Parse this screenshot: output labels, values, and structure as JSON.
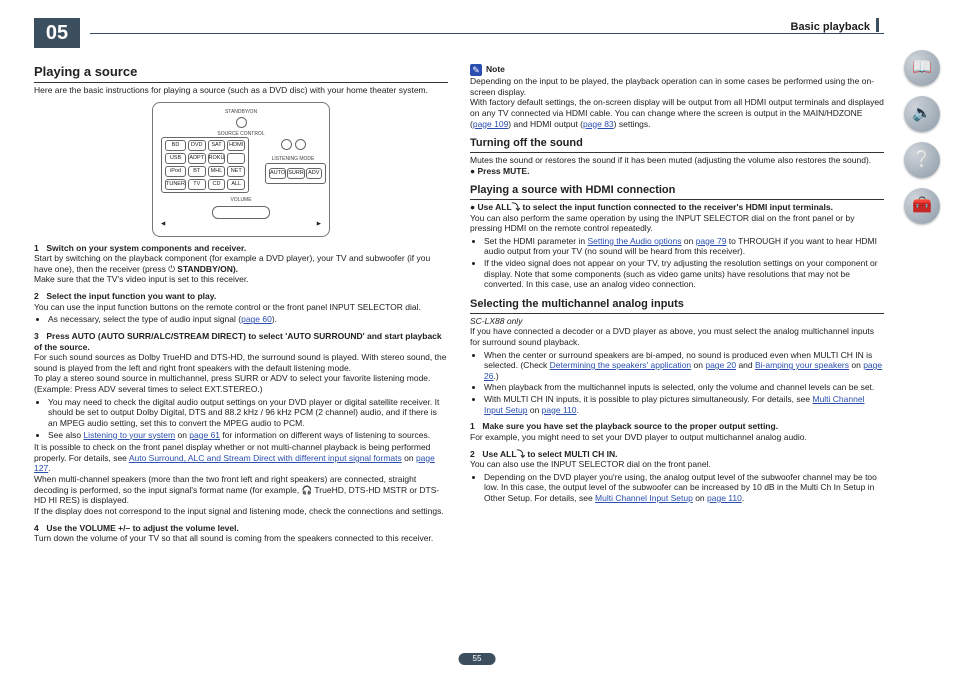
{
  "chapter": "05",
  "header": "Basic playback",
  "pagenum": "55",
  "left": {
    "title": "Playing a source",
    "intro": "Here are the basic instructions for playing a source (such as a DVD disc) with your home theater system.",
    "remote": {
      "standby": "STANDBY/ON",
      "src_lbl": "SOURCE CONTROL",
      "row1": [
        "BD",
        "DVD",
        "SAT",
        "HDMI"
      ],
      "row2": [
        "USB",
        "ADPT",
        "ROKU",
        ""
      ],
      "row3": [
        "iPod",
        "BT",
        "MHL",
        "NET"
      ],
      "row4": [
        "TUNER",
        "TV",
        "CD",
        "ALL"
      ],
      "listen_lbl": "LISTENING MODE",
      "listen": [
        "AUTO",
        "SURR",
        "ADV"
      ],
      "vol_lbl": "VOLUME"
    },
    "s1": "Switch on your system components and receiver.",
    "s1b": "Start by switching on the playback component (for example a DVD player), your TV and subwoofer (if you have one), then the receiver (press ",
    "s1c": " STANDBY/ON).",
    "s1d": "Make sure that the TV's video input is set to this receiver.",
    "s2": "Select the input function you want to play.",
    "s2b": "You can use the input function buttons on the remote control or the front panel INPUT SELECTOR dial.",
    "s2li": "As necessary, select the type of audio input signal (",
    "s2li_link": "page 60",
    "s3": "Press AUTO (AUTO SURR/ALC/STREAM DIRECT) to select 'AUTO SURROUND' and start playback of the source.",
    "s3b": "For such sound sources as Dolby TrueHD and DTS-HD, the surround sound is played. With stereo sound, the sound is played from the left and right front speakers with the default listening mode.",
    "s3c": "To play a stereo sound source in multichannel, press SURR or ADV to select your favorite listening mode. (Example: Press ADV several times to select EXT.STEREO.)",
    "s3li1": "You may need to check the digital audio output settings on your DVD player or digital satellite receiver. It should be set to output Dolby Digital, DTS and 88.2 kHz / 96 kHz PCM (2 channel) audio, and if there is an MPEG audio setting, set this to convert the MPEG audio to PCM.",
    "s3li2a": "See also ",
    "s3li2_link": "Listening to your system",
    "s3li2b": " on ",
    "s3li2_pg": "page 61",
    "s3li2c": " for information on different ways of listening to sources.",
    "s3d1": "It is possible to check on the front panel display whether or not multi-channel playback is being performed properly. For details, see ",
    "s3d1_link": "Auto Surround, ALC and Stream Direct with different input signal formats",
    "s3d1_pg": "page 127",
    "s3d2": "When multi-channel speakers (more than the two front left and right speakers) are connected, straight decoding is performed, so the input signal's format name (for example, 🎧 TrueHD, DTS-HD MSTR or DTS-HD HI RES) is displayed.",
    "s3d3": "If the display does not correspond to the input signal and listening mode, check the connections and settings.",
    "s4": "Use the VOLUME +/– to adjust the volume level.",
    "s4b": "Turn down the volume of your TV so that all sound is coming from the speakers connected to this receiver."
  },
  "right": {
    "notelabel": "Note",
    "note1": "Depending on the input to be played, the playback operation can in some cases be performed using the on-screen display.",
    "note2a": "With factory default settings, the on-screen display will be output from all HDMI output terminals and displayed on any TV connected via HDMI cable. You can change where the screen is output in the MAIN/HDZONE (",
    "note2_pg1": "page 109",
    "note2b": ") and HDMI output (",
    "note2_pg2": "page 83",
    "note2c": ") settings.",
    "turn_title": "Turning off the sound",
    "turn_body": "Mutes the sound or restores the sound if it has been muted (adjusting the volume also restores the sound).",
    "turn_step": "Press MUTE.",
    "hdmi_title": "Playing a source with HDMI connection",
    "hdmi_step": "Use ALL⤵ to select the input function connected to the receiver's HDMI input terminals.",
    "hdmi_body": "You can also perform the same operation by using the INPUT SELECTOR dial on the front panel or by pressing HDMI on the remote control repeatedly.",
    "hdmi_li1a": "Set the HDMI parameter in ",
    "hdmi_li1_link": "Setting the Audio options",
    "hdmi_li1b": " on ",
    "hdmi_li1_pg": "page 79",
    "hdmi_li1c": " to THROUGH if you want to hear HDMI audio output from your TV (no sound will be heard from this receiver).",
    "hdmi_li2": "If the video signal does not appear on your TV, try adjusting the resolution settings on your component or display. Note that some components (such as video game units) have resolutions that may not be converted. In this case, use an analog video connection.",
    "multi_title": "Selecting the multichannel analog inputs",
    "multi_note": "SC-LX88 only",
    "multi_body": "If you have connected a decoder or a DVD player as above, you must select the analog multichannel inputs for surround sound playback.",
    "multi_li1a": "When the center or surround speakers are bi-amped, no sound is produced even when MULTI CH IN is selected. (Check ",
    "multi_li1_link1": "Determining the speakers' application",
    "multi_li1b": " on ",
    "multi_li1_pg1": "page 20",
    "multi_li1c": " and ",
    "multi_li1_link2": "Bi-amping your speakers",
    "multi_li1d": " on ",
    "multi_li1_pg2": "page 26",
    "multi_li1e": ".)",
    "multi_li2": "When playback from the multichannel inputs is selected, only the volume and channel levels can be set.",
    "multi_li3a": "With MULTI CH IN inputs, it is possible to play pictures simultaneously. For details, see ",
    "multi_li3_link": "Multi Channel Input Setup",
    "multi_li3b": " on ",
    "multi_li3_pg": "page 110",
    "m_s1": "Make sure you have set the playback source to the proper output setting.",
    "m_s1b": "For example, you might need to set your DVD player to output multichannel analog audio.",
    "m_s2": "Use ALL⤵ to select MULTI CH IN.",
    "m_s2b": "You can also use the INPUT SELECTOR dial on the front panel.",
    "m_s2_li_a": "Depending on the DVD player you're using, the analog output level of the subwoofer channel may be too low. In this case, the output level of the subwoofer can be increased by 10 dB in the Multi Ch In Setup in Other Setup. For details, see ",
    "m_s2_li_link": "Multi Channel Input Setup",
    "m_s2_li_b": " on ",
    "m_s2_li_pg": "page 110"
  }
}
